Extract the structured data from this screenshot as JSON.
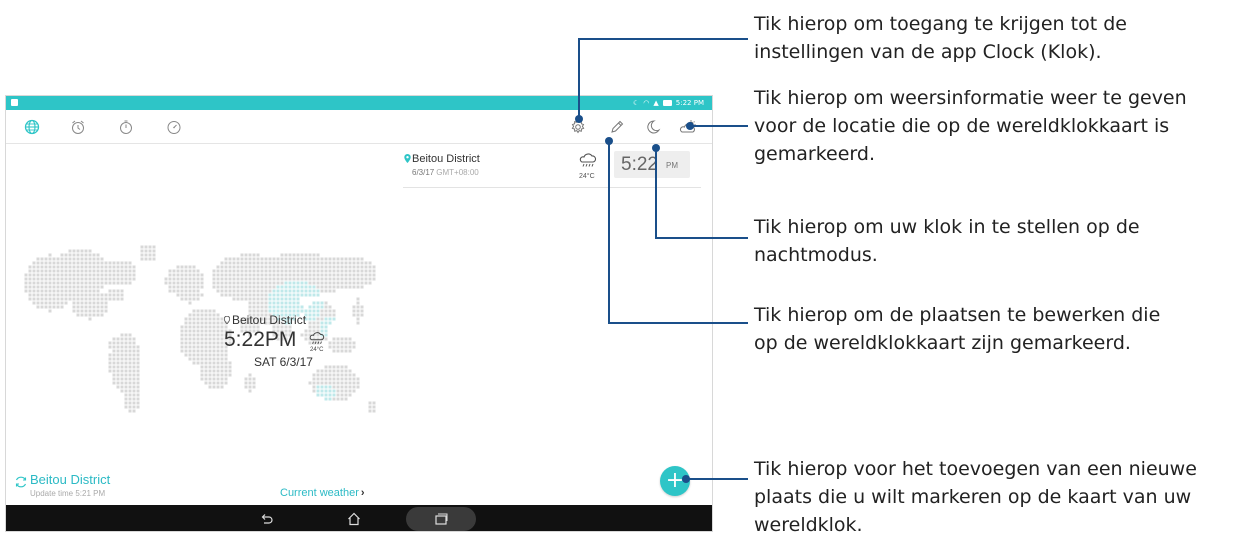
{
  "status_bar": {
    "time": "5:22 PM",
    "icons": [
      "moon-icon",
      "wifi-icon",
      "signal-icon",
      "battery-icon"
    ]
  },
  "tabs": [
    {
      "name": "world-clock",
      "icon": "globe-icon",
      "active": true
    },
    {
      "name": "alarm",
      "icon": "alarm-clock-icon"
    },
    {
      "name": "stopwatch",
      "icon": "stopwatch-icon"
    },
    {
      "name": "timer",
      "icon": "timer-icon"
    }
  ],
  "toolbar": {
    "icons": [
      "gear-icon",
      "pencil-icon",
      "moon-icon",
      "weather-icon"
    ]
  },
  "city_card": {
    "name": "Beitou District",
    "date": "6/3/17",
    "gmt": "GMT+08:00",
    "temp": "24°C",
    "time": "5:22",
    "ampm": "PM"
  },
  "map_info": {
    "city": "Beitou District",
    "time": "5:22PM",
    "temp": "24°C",
    "date": "SAT 6/3/17"
  },
  "weather_bar": {
    "location": "Beitou District",
    "update_time": "Update time 5:21 PM",
    "current_weather": "Current weather",
    "chevron": "›"
  },
  "fab": {
    "label": "+"
  },
  "annotations": {
    "settings": [
      "Tik hierop om toegang te krijgen tot de",
      "instellingen van de app Clock (Klok)."
    ],
    "weather": [
      "Tik hierop om weersinformatie weer te geven",
      "voor de locatie die op de wereldklokkaart is",
      "gemarkeerd."
    ],
    "night": [
      "Tik hierop om uw klok in te stellen op de",
      "nachtmodus."
    ],
    "edit": [
      "Tik hierop om de plaatsen te bewerken die",
      "op de wereldklokkaart zijn gemarkeerd."
    ],
    "add": [
      "Tik hierop voor het toevoegen van een nieuwe",
      "plaats die u wilt markeren op de kaart van uw",
      "wereldklok."
    ]
  },
  "colors": {
    "accent": "#2ec5c7",
    "accent_text": "#2bbac5",
    "leader_line": "#1a4f8a",
    "map_dots": "#d8d8d8",
    "map_highlight": "#bfe8ea",
    "navbar": "#111111"
  }
}
